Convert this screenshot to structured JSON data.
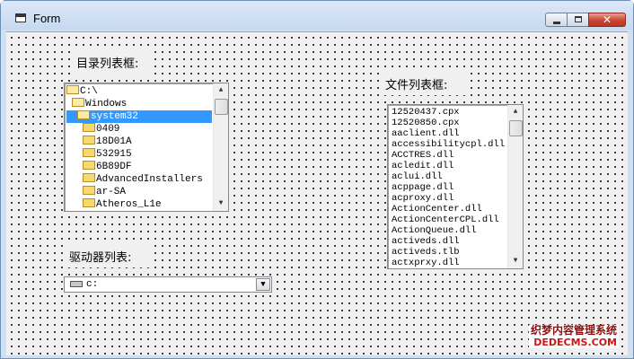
{
  "window": {
    "title": "Form",
    "buttons": {
      "minimize": "minimize",
      "maximize": "maximize",
      "close": "✕"
    }
  },
  "labels": {
    "dir_list": "目录列表框:",
    "file_list": "文件列表框:",
    "drive_list": "驱动器列表:"
  },
  "dir_list": {
    "items": [
      {
        "name": "C:\\",
        "icon": "folder-open-icon",
        "indent": 0
      },
      {
        "name": "Windows",
        "icon": "folder-open-icon",
        "indent": 1
      },
      {
        "name": "system32",
        "icon": "folder-open-icon",
        "indent": 2,
        "selected": true
      },
      {
        "name": "0409",
        "icon": "folder-icon",
        "indent": 3
      },
      {
        "name": "18D01A",
        "icon": "folder-icon",
        "indent": 3
      },
      {
        "name": "532915",
        "icon": "folder-icon",
        "indent": 3
      },
      {
        "name": "6B89DF",
        "icon": "folder-icon",
        "indent": 3
      },
      {
        "name": "AdvancedInstallers",
        "icon": "folder-icon",
        "indent": 3
      },
      {
        "name": "ar-SA",
        "icon": "folder-icon",
        "indent": 3
      },
      {
        "name": "Atheros_L1e",
        "icon": "folder-icon",
        "indent": 3
      }
    ]
  },
  "file_list": {
    "items": [
      "12520437.cpx",
      "12520850.cpx",
      "aaclient.dll",
      "accessibilitycpl.dll",
      "ACCTRES.dll",
      "acledit.dll",
      "aclui.dll",
      "acppage.dll",
      "acproxy.dll",
      "ActionCenter.dll",
      "ActionCenterCPL.dll",
      "ActionQueue.dll",
      "activeds.dll",
      "activeds.tlb",
      "actxprxy.dll"
    ]
  },
  "drive_list": {
    "value": "c:",
    "icon": "drive-icon"
  },
  "watermark": {
    "line1": "织梦内容管理系统",
    "line2": "DEDECMS.COM"
  }
}
